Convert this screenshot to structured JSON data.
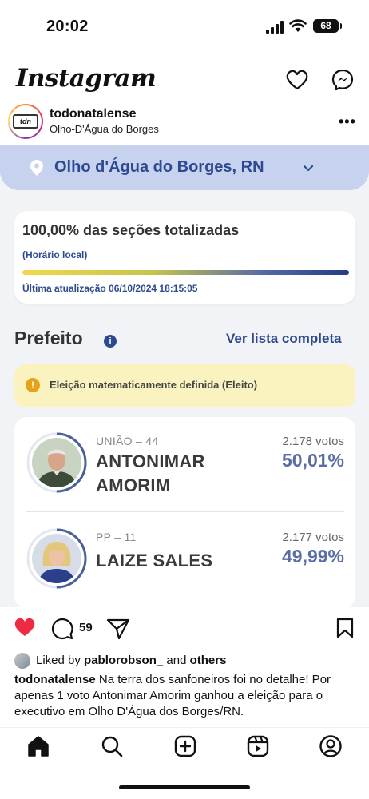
{
  "status_bar": {
    "time": "20:02",
    "battery": "68"
  },
  "header": {
    "app_name": "Instagram"
  },
  "post": {
    "username": "todonatalense",
    "location": "Olho-D'Água do Borges",
    "avatar_text": "tdn"
  },
  "election": {
    "city": "Olho d'Água do Borges, RN",
    "sections_text": "100,00% das seções totalizadas",
    "local_time_note": "(Horário local)",
    "progress_fraction": 1.0,
    "last_update": "Última atualização 06/10/2024 18:15:05",
    "office": "Prefeito",
    "see_full_list": "Ver lista completa",
    "notice": "Eleição matematicamente definida (Eleito)",
    "candidates": [
      {
        "party": "UNIÃO – 44",
        "name_line1": "ANTONIMAR",
        "name_line2": "AMORIM",
        "votes": "2.178 votos",
        "percent": "50,01%",
        "share": 0.5001
      },
      {
        "party": "PP – 11",
        "name_line1": "LAIZE SALES",
        "name_line2": "",
        "votes": "2.177 votos",
        "percent": "49,99%",
        "share": 0.4999
      }
    ]
  },
  "actions": {
    "comment_count": "59"
  },
  "likes": {
    "prefix": "Liked by ",
    "user": "pablorobson_",
    "middle": " and ",
    "others": "others"
  },
  "caption": {
    "user": "todonatalense",
    "text": " Na terra dos sanfoneiros foi no detalhe! Por apenas 1 voto Antonimar Amorim ganhou a eleição para o executivo em Olho D'Água dos Borges/RN."
  },
  "colors": {
    "accent_blue": "#2e4a8f",
    "location_bar": "#c7d3ee",
    "notice_bg": "#fbf3bf",
    "like_red": "#ee2a45"
  },
  "icons": [
    "signal-icon",
    "wifi-icon",
    "battery-icon",
    "chevron-down-icon",
    "heart-icon",
    "messenger-icon",
    "more-icon",
    "map-pin-icon",
    "info-icon",
    "warning-icon",
    "comment-icon",
    "share-icon",
    "bookmark-icon",
    "home-icon",
    "search-icon",
    "create-icon",
    "reels-icon",
    "profile-icon"
  ]
}
